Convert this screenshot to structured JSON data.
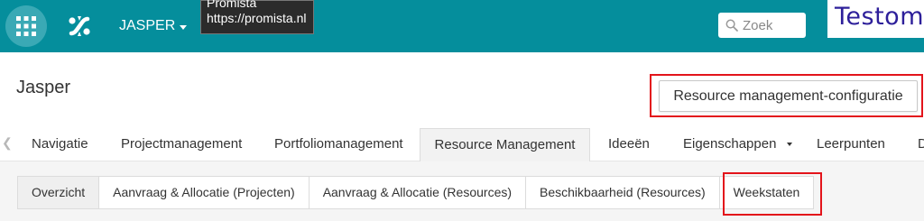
{
  "topbar": {
    "site_name": "JASPER",
    "tooltip": {
      "line1": "Promista",
      "line2": "https://promista.nl"
    },
    "search": {
      "placeholder": "Zoek",
      "value": ""
    },
    "brand_text": "Testomg"
  },
  "header": {
    "title": "Jasper",
    "config_button": "Resource management-configuratie"
  },
  "main_tabs": {
    "items": [
      {
        "label": "Navigatie"
      },
      {
        "label": "Projectmanagement"
      },
      {
        "label": "Portfoliomanagement"
      },
      {
        "label": "Resource Management",
        "active": true
      },
      {
        "label": "Ideeën"
      },
      {
        "label": "Eigenschappen"
      },
      {
        "label": "Leerpunten"
      },
      {
        "label": "D"
      }
    ]
  },
  "sub_tabs": {
    "items": [
      {
        "label": "Overzicht",
        "active": true
      },
      {
        "label": "Aanvraag & Allocatie (Projecten)"
      },
      {
        "label": "Aanvraag & Allocatie (Resources)"
      },
      {
        "label": "Beschikbaarheid (Resources)"
      },
      {
        "label": "Weekstaten"
      }
    ]
  },
  "colors": {
    "topbar": "#058e9c",
    "highlight": "#e3141b",
    "brand_text": "#2d1f9a"
  },
  "icons": [
    "app-launcher-icon",
    "promista-logo-icon",
    "search-icon",
    "chevron-left-icon"
  ]
}
